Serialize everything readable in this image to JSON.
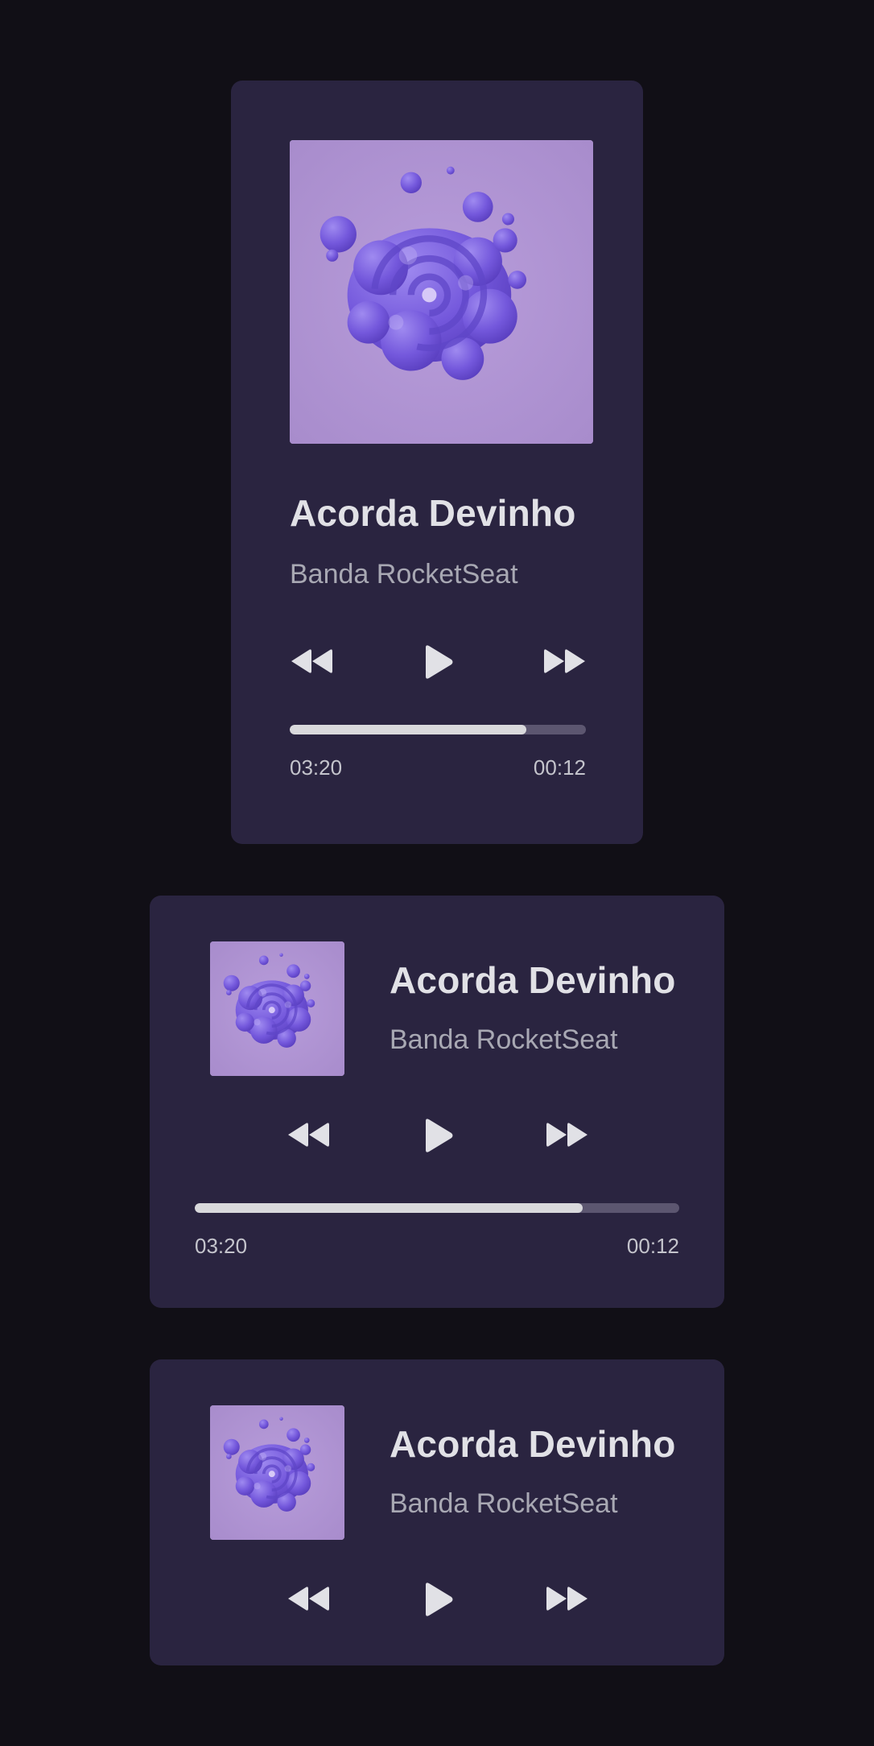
{
  "colors": {
    "background": "#110f16",
    "card": "#2a2440",
    "title": "#e1e1e6",
    "artist": "#a8a8b3",
    "progress_fill": "#d9d9dc",
    "progress_track": "#5c5670",
    "cover_background": "#b79ed8",
    "cover_art": "#7b5ce0"
  },
  "icons": {
    "previous": "rewind-icon",
    "play": "play-icon",
    "next": "fast-forward-icon"
  },
  "players": [
    {
      "layout": "vertical",
      "song_title": "Acorda Devinho",
      "artist": "Banda RocketSeat",
      "time_current": "03:20",
      "time_total": "00:12",
      "progress": 0.8
    },
    {
      "layout": "horizontal",
      "song_title": "Acorda Devinho",
      "artist": "Banda RocketSeat",
      "time_current": "03:20",
      "time_total": "00:12",
      "progress": 0.8
    },
    {
      "layout": "compact",
      "song_title": "Acorda Devinho",
      "artist": "Banda RocketSeat"
    }
  ]
}
